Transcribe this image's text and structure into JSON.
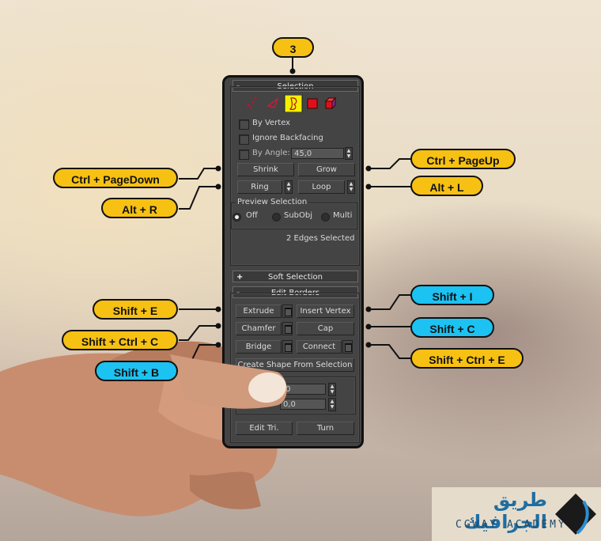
{
  "step_badge": "3",
  "panel": {
    "selection": {
      "title": "Selection",
      "collapse_sign": "-",
      "subobject_icons": [
        "vertex-icon",
        "edge-icon",
        "border-icon",
        "polygon-icon",
        "element-icon"
      ],
      "active_subobject": "border",
      "by_vertex": "By Vertex",
      "ignore_backfacing": "Ignore Backfacing",
      "by_angle": "By Angle:",
      "by_angle_value": "45,0",
      "shrink": "Shrink",
      "grow": "Grow",
      "ring": "Ring",
      "loop": "Loop",
      "preview_selection": {
        "title": "Preview Selection",
        "options": [
          "Off",
          "SubObj",
          "Multi"
        ],
        "selected": "Off"
      },
      "status": "2 Edges Selected"
    },
    "soft_selection": {
      "title": "Soft Selection",
      "expand_sign": "+"
    },
    "edit_borders": {
      "title": "Edit Borders",
      "collapse_sign": "-",
      "extrude": "Extrude",
      "insert_vertex": "Insert Vertex",
      "chamfer": "Chamfer",
      "cap": "Cap",
      "bridge": "Bridge",
      "connect": "Connect",
      "create_shape": "Create Shape From Selection",
      "value1": ",0",
      "value2": "0,0",
      "edit_tri": "Edit Tri.",
      "turn": "Turn"
    }
  },
  "callouts": {
    "shrink": "Ctrl + PageDown",
    "ring": "Alt + R",
    "grow": "Ctrl + PageUp",
    "loop": "Alt + L",
    "extrude": "Shift + E",
    "chamfer": "Shift + Ctrl + C",
    "bridge": "Shift + B",
    "insert_vertex": "Shift + I",
    "cap": "Shift + C",
    "connect": "Shift + Ctrl + E"
  },
  "colors": {
    "callout_yellow": "#f7c114",
    "callout_blue": "#1cc2f2",
    "panel_bg": "#444444"
  },
  "logo": {
    "arabic": "طريق الجرافيك",
    "english": "CGWAY ACADEMY"
  }
}
